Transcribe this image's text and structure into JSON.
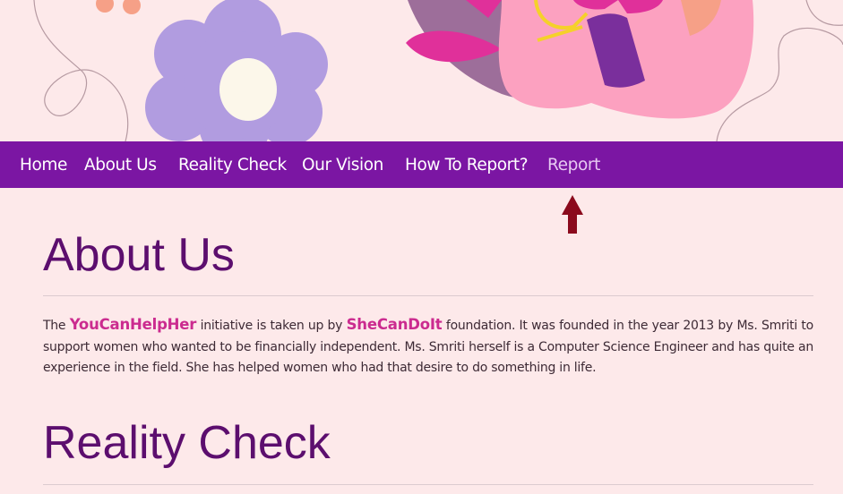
{
  "nav": {
    "items": [
      {
        "label": "Home"
      },
      {
        "label": "About Us"
      },
      {
        "label": "Reality Check"
      },
      {
        "label": "Our Vision"
      },
      {
        "label": "How To Report?"
      },
      {
        "label": "Report"
      }
    ]
  },
  "about": {
    "heading": "About Us",
    "p1": "The ",
    "brand1": "YouCanHelpHer",
    "p2": " initiative is taken up by ",
    "brand2": "SheCanDoIt",
    "p3": " foundation. It was founded in the year 2013 by Ms. Smriti to support women who wanted to be financially independent. Ms. Smriti herself is a Computer Science Engineer and has quite an experience in the field. She has helped women who had that desire to do something in life."
  },
  "reality": {
    "heading": "Reality Check"
  },
  "colors": {
    "page_background": "#fde9ea",
    "nav_background": "#7b16a3",
    "heading": "#5c0e6e",
    "brand_highlight": "#cb2b8f",
    "arrow": "#8b0a1d"
  },
  "icons": {
    "arrow": "arrow-up-icon"
  }
}
